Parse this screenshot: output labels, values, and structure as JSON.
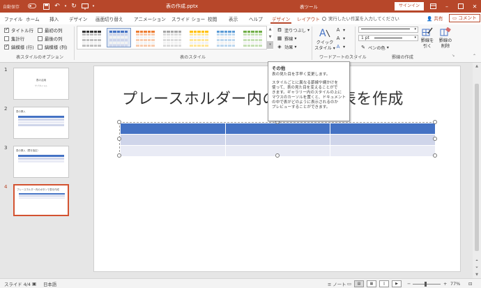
{
  "titlebar": {
    "autosave_label": "自動保存",
    "doc_title": "表の作成.pptx",
    "context_tools_title": "表ツール",
    "signin_label": "サインイン",
    "brand_color": "#b7472a"
  },
  "tabs": [
    {
      "label": "ファイル"
    },
    {
      "label": "ホーム"
    },
    {
      "label": "挿入"
    },
    {
      "label": "デザイン"
    },
    {
      "label": "画面切り替え"
    },
    {
      "label": "アニメーション"
    },
    {
      "label": "スライド ショー"
    },
    {
      "label": "校閲"
    },
    {
      "label": "表示"
    },
    {
      "label": "ヘルプ"
    },
    {
      "label": "デザイン",
      "active": true
    },
    {
      "label": "レイアウト",
      "contextual": true
    }
  ],
  "tellme": "実行したい作業を入力してください",
  "share_label": "共有",
  "comment_label": "コメント",
  "ribbon": {
    "style_options": {
      "label": "表スタイルのオプション",
      "items": [
        {
          "label": "タイトル行",
          "checked": true
        },
        {
          "label": "最初の列",
          "checked": false
        },
        {
          "label": "集計行",
          "checked": false
        },
        {
          "label": "最後の列",
          "checked": false
        },
        {
          "label": "縞模様 (行)",
          "checked": true
        },
        {
          "label": "縞模様 (列)",
          "checked": false
        }
      ]
    },
    "table_styles": {
      "label": "表のスタイル",
      "swatches": [
        {
          "header": "#333333",
          "band": "#bfbfbf"
        },
        {
          "header": "#4472c4",
          "band": "#cfd5ea"
        },
        {
          "header": "#ed7d31",
          "band": "#f8cbad"
        },
        {
          "header": "#a5a5a5",
          "band": "#dbdbdb"
        },
        {
          "header": "#ffc000",
          "band": "#ffe699"
        },
        {
          "header": "#5b9bd5",
          "band": "#bdd7ee"
        },
        {
          "header": "#70ad47",
          "band": "#c5e0b4"
        }
      ],
      "shading_label": "塗りつぶし",
      "borders_label": "罫線",
      "effects_label": "効果"
    },
    "wordart": {
      "label": "ワードアートのスタイル",
      "quick_styles_label": "クイック\nスタイル"
    },
    "borders": {
      "label": "罫線の作成",
      "pen_weight": "1 pt",
      "pen_color_label": "ペンの色",
      "draw_table_label": "罫線を\n引く",
      "eraser_label": "罫線の\n削除"
    }
  },
  "slides": [
    {
      "number": "1",
      "title": "表の活用",
      "subtitle": "サブタイトル"
    },
    {
      "number": "2",
      "title": "表の挿入"
    },
    {
      "number": "3",
      "title": "表の挿入（罫を指定）"
    },
    {
      "number": "4",
      "title": "プレースホルダー内のボタンで表を作成",
      "active": true
    }
  ],
  "slide": {
    "title": "プレースホルダー内のボタンで表を作成",
    "table_header_color": "#4472c4",
    "table_band_odd": "#cfd5ea",
    "table_band_even": "#e9ebf5"
  },
  "tooltip": {
    "title": "その他",
    "line1": "表の見た目を手早く変更します。",
    "body": [
      "スタイルごとに異なる罫線や網かけを",
      "使って、表の見た目を変えることがで",
      "きます。ギャラリー内のスタイルの上に",
      "マウスのカーソルを置くと、ドキュメント",
      "の中で表がどのように表示されるのか",
      "プレビューすることができます。"
    ]
  },
  "status": {
    "slide_indicator": "スライド 4/4",
    "language": "日本語",
    "notes_label": "ノート",
    "zoom": "77%"
  }
}
